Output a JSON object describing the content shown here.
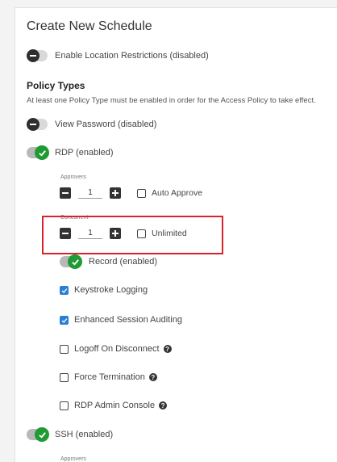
{
  "title": "Create New Schedule",
  "location_toggle": {
    "label": "Enable Location Restrictions (disabled)",
    "on": false
  },
  "policy": {
    "heading": "Policy Types",
    "description": "At least one Policy Type must be enabled in order for the Access Policy to take effect."
  },
  "view_password_toggle": {
    "label": "View Password (disabled)",
    "on": false
  },
  "rdp_toggle": {
    "label": "RDP (enabled)",
    "on": true
  },
  "rdp": {
    "approvers_label": "Approvers",
    "approvers_value": "1",
    "auto_approve_label": "Auto Approve",
    "concurrent_label": "Concurrent",
    "concurrent_value": "1",
    "unlimited_label": "Unlimited",
    "record_label": "Record (enabled)",
    "options": [
      {
        "label": "Keystroke Logging",
        "checked": true,
        "help": false
      },
      {
        "label": "Enhanced Session Auditing",
        "checked": true,
        "help": false
      },
      {
        "label": "Logoff On Disconnect",
        "checked": false,
        "help": true
      },
      {
        "label": "Force Termination",
        "checked": false,
        "help": true
      },
      {
        "label": "RDP Admin Console",
        "checked": false,
        "help": true
      }
    ]
  },
  "ssh_toggle": {
    "label": "SSH (enabled)",
    "on": true
  },
  "ssh": {
    "approvers_label": "Approvers"
  },
  "colors": {
    "toggle_on": "#1f9b33",
    "checkbox_checked": "#2a7fd4",
    "highlight": "#d9232a"
  }
}
